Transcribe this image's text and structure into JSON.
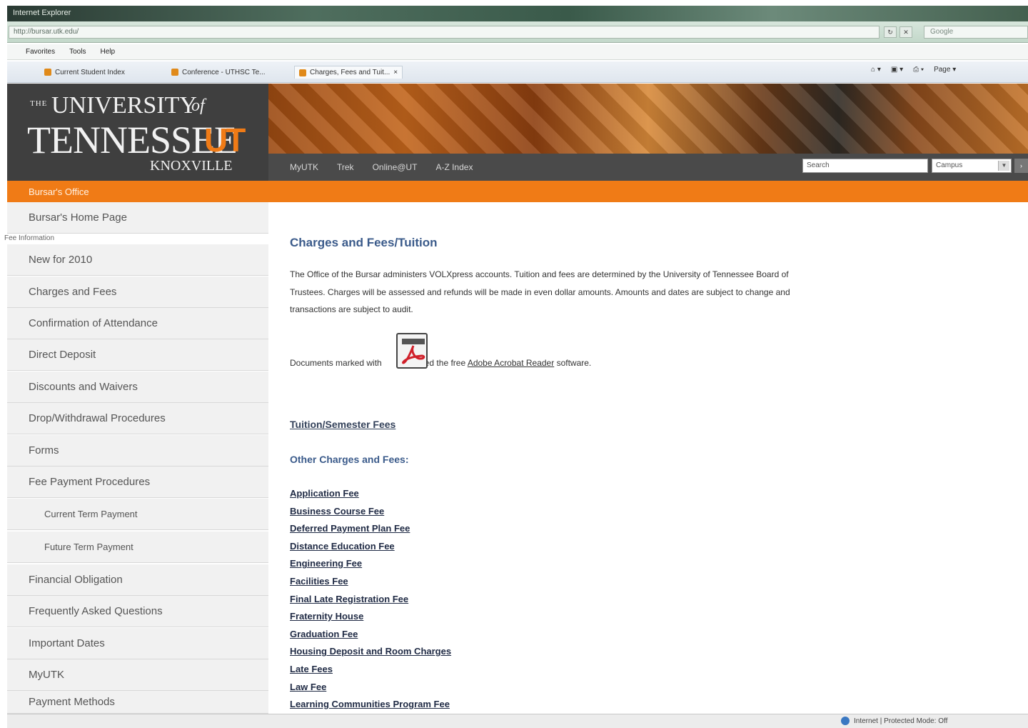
{
  "browser": {
    "title": "Internet Explorer",
    "address": "http://bursar.utk.edu/",
    "search_placeholder": "Google",
    "refresh_icon": "refresh-icon",
    "stop_icon": "stop-icon",
    "menu": [
      "Favorites",
      "Tools",
      "Help"
    ],
    "tabs": [
      {
        "label": "Current Student Index"
      },
      {
        "label": "Conference - UTHSC Te..."
      },
      {
        "label": "Charges, Fees and Tuit..."
      }
    ],
    "tab_close": "×",
    "cmd": {
      "page": "Page ▾"
    },
    "status": "Internet | Protected Mode: Off"
  },
  "site": {
    "logo": {
      "the": "THE",
      "university": "UNIVERSITY",
      "of": "of",
      "tennessee": "TENNESSEE",
      "ut": "UT",
      "knoxville": "KNOXVILLE"
    },
    "nav": [
      "MyUTK",
      "Trek",
      "Online@UT",
      "A-Z Index"
    ],
    "search_placeholder": "Search",
    "campus": "Campus",
    "section": "Bursar's Office"
  },
  "sidebar": {
    "fee_label": "Fee Information",
    "items": [
      {
        "label": "Bursar's Home Page"
      },
      {
        "label": "New for 2010"
      },
      {
        "label": "Charges and Fees"
      },
      {
        "label": "Confirmation of Attendance"
      },
      {
        "label": "Direct Deposit"
      },
      {
        "label": "Discounts and Waivers"
      },
      {
        "label": "Drop/Withdrawal Procedures"
      },
      {
        "label": "Forms"
      },
      {
        "label": "Fee Payment Procedures"
      },
      {
        "label": "Current Term Payment"
      },
      {
        "label": "Future Term Payment"
      },
      {
        "label": "Financial Obligation"
      },
      {
        "label": "Frequently Asked Questions"
      },
      {
        "label": "Important Dates"
      },
      {
        "label": "MyUTK"
      },
      {
        "label": "Payment Methods"
      }
    ]
  },
  "main": {
    "title": "Charges and Fees/Tuition",
    "intro": "The Office of the Bursar administers VOLXpress accounts. Tuition and fees are determined by the University of Tennessee Board of Trustees. Charges will be assessed and refunds will be made in even dollar amounts. Amounts and dates are subject to change and transactions are subject to audit.",
    "pdf_note_before": "Documents marked with",
    "pdf_note_middle": "need the free",
    "pdf_link": "Adobe Acrobat Reader",
    "pdf_note_after": "software.",
    "tuition_link": "Tuition/Semester Fees",
    "other_heading": "Other Charges and Fees:",
    "fees": [
      "Application Fee",
      "Business Course Fee",
      "Deferred Payment Plan Fee",
      "Distance Education Fee",
      "Engineering Fee",
      "Facilities Fee",
      "Final Late Registration Fee",
      "Fraternity House",
      "Graduation Fee",
      "Housing Deposit and Room Charges",
      "Late Fees",
      "Law Fee",
      "Learning Communities Program Fee"
    ]
  },
  "colors": {
    "ut_orange": "#f07b16",
    "header_gray": "#3f3f3f",
    "link_blue": "#3a5a8a"
  }
}
